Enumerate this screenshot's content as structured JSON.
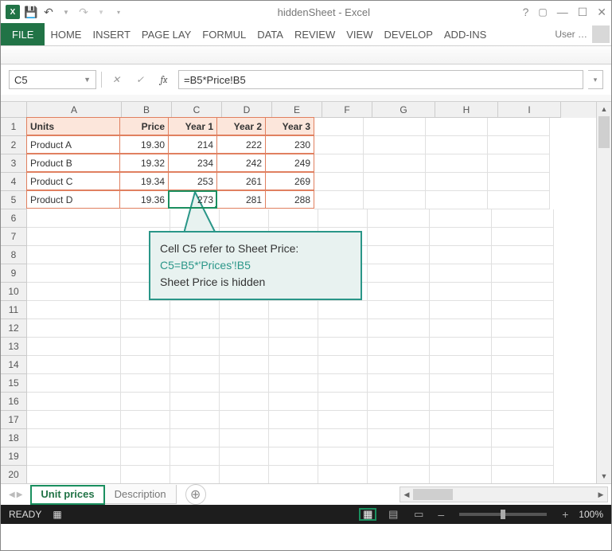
{
  "titlebar": {
    "doc": "hiddenSheet",
    "app": " - Excel"
  },
  "ribbon": {
    "file": "FILE",
    "tabs": [
      "HOME",
      "INSERT",
      "PAGE LAY",
      "FORMUL",
      "DATA",
      "REVIEW",
      "VIEW",
      "DEVELOP",
      "ADD-INS"
    ],
    "user": "User …"
  },
  "namebox": "C5",
  "formula": "=B5*Price!B5",
  "columns": [
    "A",
    "B",
    "C",
    "D",
    "E",
    "F",
    "G",
    "H",
    "I"
  ],
  "rows": [
    "1",
    "2",
    "3",
    "4",
    "5",
    "6",
    "7",
    "8",
    "9",
    "10",
    "11",
    "12",
    "13",
    "14",
    "15",
    "16",
    "17",
    "18",
    "19",
    "20"
  ],
  "header_row": {
    "A": "Units",
    "B": "Price",
    "C": "Year 1",
    "D": "Year 2",
    "E": "Year 3"
  },
  "data_rows": [
    {
      "A": "Product A",
      "B": "19.30",
      "C": "214",
      "D": "222",
      "E": "230"
    },
    {
      "A": "Product B",
      "B": "19.32",
      "C": "234",
      "D": "242",
      "E": "249"
    },
    {
      "A": "Product C",
      "B": "19.34",
      "C": "253",
      "D": "261",
      "E": "269"
    },
    {
      "A": "Product D",
      "B": "19.36",
      "C": "273",
      "D": "281",
      "E": "288"
    }
  ],
  "callout": {
    "l1": "Cell C5 refer to Sheet Price:",
    "l2": "C5=B5*'Prices'!B5",
    "l3": "Sheet Price is hidden"
  },
  "sheets": {
    "active": "Unit prices",
    "other": "Description"
  },
  "status": {
    "ready": "READY",
    "zoom": "100%"
  },
  "chart_data": {
    "type": "table",
    "index": [
      "Product A",
      "Product B",
      "Product C",
      "Product D"
    ],
    "columns": [
      "Price",
      "Year 1",
      "Year 2",
      "Year 3"
    ],
    "data": [
      [
        19.3,
        214,
        222,
        230
      ],
      [
        19.32,
        234,
        242,
        249
      ],
      [
        19.34,
        253,
        261,
        269
      ],
      [
        19.36,
        273,
        281,
        288
      ]
    ],
    "active_cell": "C5",
    "active_formula": "=B5*Price!B5",
    "note": "Sheet 'Price' is hidden"
  }
}
